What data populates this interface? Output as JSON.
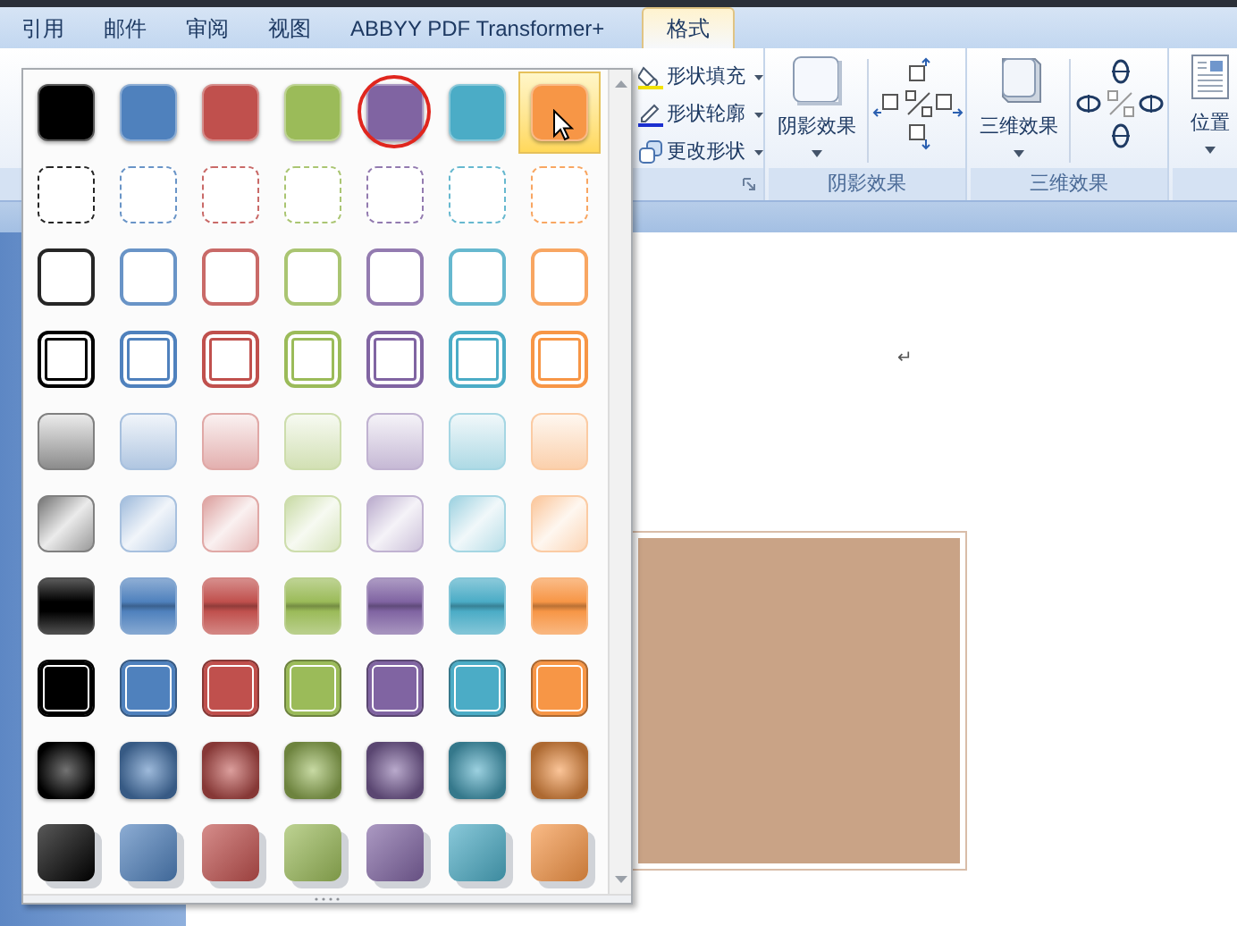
{
  "tabs": [
    {
      "label": "引用",
      "selected": false
    },
    {
      "label": "邮件",
      "selected": false
    },
    {
      "label": "审阅",
      "selected": false
    },
    {
      "label": "视图",
      "selected": false
    },
    {
      "label": "ABBYY PDF Transformer+",
      "selected": false
    },
    {
      "label": "格式",
      "selected": true
    }
  ],
  "ribbon": {
    "shape_commands": [
      {
        "label": "形状填充"
      },
      {
        "label": "形状轮廓"
      },
      {
        "label": "更改形状"
      }
    ],
    "shadow_group": {
      "button": "阴影效果",
      "label": "阴影效果"
    },
    "threed_group": {
      "button": "三维效果",
      "label": "三维效果"
    },
    "position_button": "位置"
  },
  "gallery": {
    "columns": [
      {
        "color": "#000000",
        "hovered": false,
        "circled": false
      },
      {
        "color": "#4f81bd",
        "hovered": false,
        "circled": false
      },
      {
        "color": "#c0504d",
        "hovered": false,
        "circled": false
      },
      {
        "color": "#9bbb59",
        "hovered": false,
        "circled": false
      },
      {
        "color": "#8064a2",
        "hovered": false,
        "circled": true
      },
      {
        "color": "#4bacc6",
        "hovered": false,
        "circled": false
      },
      {
        "color": "#f79646",
        "hovered": true,
        "circled": false
      }
    ],
    "rows": [
      {
        "kind": "solid",
        "hovered": true
      },
      {
        "kind": "dashed",
        "hovered": false
      },
      {
        "kind": "outline",
        "hovered": false
      },
      {
        "kind": "double",
        "hovered": false
      },
      {
        "kind": "pale",
        "hovered": false
      },
      {
        "kind": "diagonal",
        "hovered": false
      },
      {
        "kind": "glossy",
        "hovered": false
      },
      {
        "kind": "framed",
        "hovered": false
      },
      {
        "kind": "radial",
        "hovered": false
      },
      {
        "kind": "shadowed",
        "hovered": false
      }
    ]
  },
  "document": {
    "paragraph_mark": "↵"
  }
}
